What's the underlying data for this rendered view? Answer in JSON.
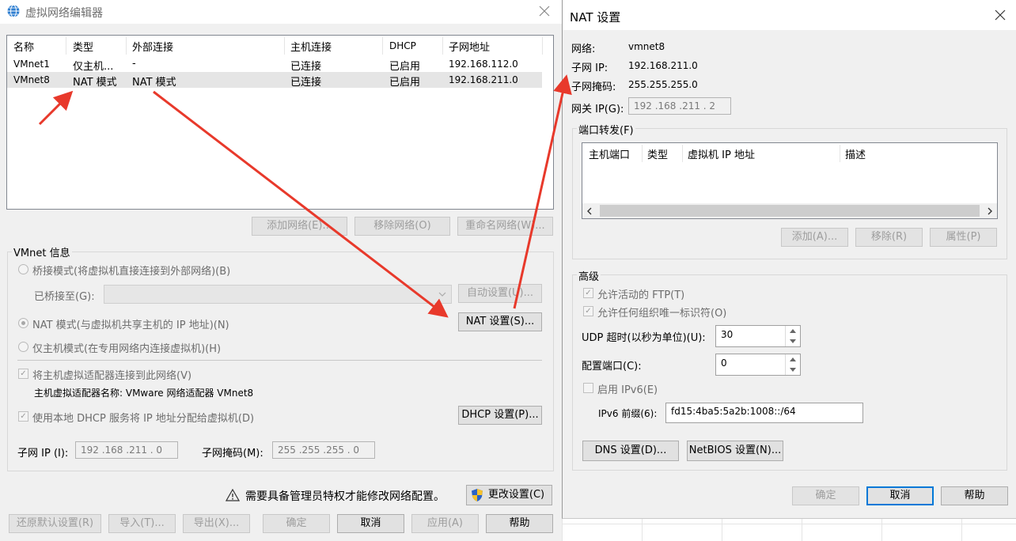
{
  "editor": {
    "title": "虚拟网络编辑器",
    "columns": [
      "名称",
      "类型",
      "外部连接",
      "主机连接",
      "DHCP",
      "子网地址"
    ],
    "rows": [
      [
        "VMnet1",
        "仅主机...",
        "-",
        "已连接",
        "已启用",
        "192.168.112.0"
      ],
      [
        "VMnet8",
        "NAT 模式",
        "NAT 模式",
        "已连接",
        "已启用",
        "192.168.211.0"
      ]
    ],
    "add_network": "添加网络(E)...",
    "remove_network": "移除网络(O)",
    "rename_network": "重命名网络(W)...",
    "vmnet_info": "VMnet 信息",
    "bridge_mode": "桥接模式(将虚拟机直接连接到外部网络)(B)",
    "bridged_to": "已桥接至(G):",
    "auto_settings": "自动设置(U)...",
    "nat_mode": "NAT 模式(与虚拟机共享主机的 IP 地址)(N)",
    "nat_settings": "NAT 设置(S)...",
    "host_only": "仅主机模式(在专用网络内连接虚拟机)(H)",
    "connect_adapter": "将主机虚拟适配器连接到此网络(V)",
    "adapter_name": "主机虚拟适配器名称: VMware 网络适配器 VMnet8",
    "use_dhcp": "使用本地 DHCP 服务将 IP 地址分配给虚拟机(D)",
    "dhcp_settings": "DHCP 设置(P)...",
    "subnet_ip_label": "子网 IP (I):",
    "subnet_ip": "192 .168 .211 . 0",
    "subnet_mask_label": "子网掩码(M):",
    "subnet_mask": "255 .255 .255 . 0",
    "admin_warning": "需要具备管理员特权才能修改网络配置。",
    "change_settings": "更改设置(C)",
    "restore_defaults": "还原默认设置(R)",
    "import": "导入(T)...",
    "export": "导出(X)...",
    "ok": "确定",
    "cancel": "取消",
    "apply": "应用(A)",
    "help": "帮助"
  },
  "nat": {
    "title": "NAT 设置",
    "network_label": "网络:",
    "network_value": "vmnet8",
    "subnet_ip_label": "子网 IP:",
    "subnet_ip_value": "192.168.211.0",
    "subnet_mask_label": "子网掩码:",
    "subnet_mask_value": "255.255.255.0",
    "gateway_label": "网关 IP(G):",
    "gateway_value": "192 .168 .211 . 2",
    "port_forwarding": "端口转发(F)",
    "pf_columns": [
      "主机端口",
      "类型",
      "虚拟机 IP 地址",
      "描述"
    ],
    "add": "添加(A)...",
    "remove": "移除(R)",
    "properties": "属性(P)",
    "advanced": "高级",
    "allow_ftp": "允许活动的 FTP(T)",
    "allow_oui": "允许任何组织唯一标识符(O)",
    "udp_timeout_label": "UDP 超时(以秒为单位)(U):",
    "udp_timeout_value": "30",
    "config_port_label": "配置端口(C):",
    "config_port_value": "0",
    "enable_ipv6": "启用 IPv6(E)",
    "ipv6_prefix_label": "IPv6 前缀(6):",
    "ipv6_prefix_value": "fd15:4ba5:5a2b:1008::/64",
    "dns_settings": "DNS 设置(D)...",
    "netbios_settings": "NetBIOS 设置(N)...",
    "ok": "确定",
    "cancel": "取消",
    "help": "帮助"
  },
  "colors": {
    "arrow": "#e8392b",
    "accent": "#0078d7"
  }
}
